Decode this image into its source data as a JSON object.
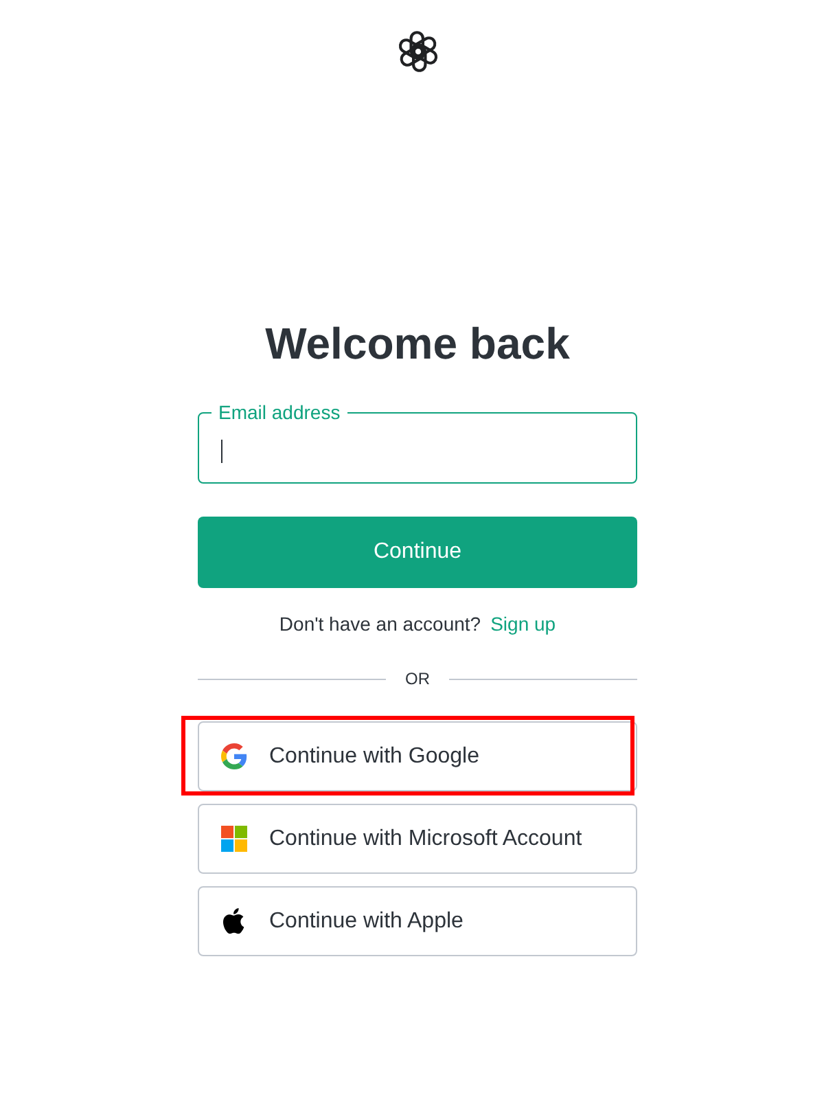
{
  "heading": "Welcome back",
  "email_field": {
    "label": "Email address",
    "focused": true
  },
  "continue_button": {
    "label": "Continue"
  },
  "signup_prompt": {
    "text": "Don't have an account?",
    "link": "Sign up"
  },
  "divider": {
    "label": "OR"
  },
  "providers": [
    {
      "kind": "google",
      "label": "Continue with Google",
      "highlighted": true
    },
    {
      "kind": "microsoft",
      "label": "Continue with Microsoft Account",
      "highlighted": false
    },
    {
      "kind": "apple",
      "label": "Continue with Apple",
      "highlighted": false
    }
  ]
}
